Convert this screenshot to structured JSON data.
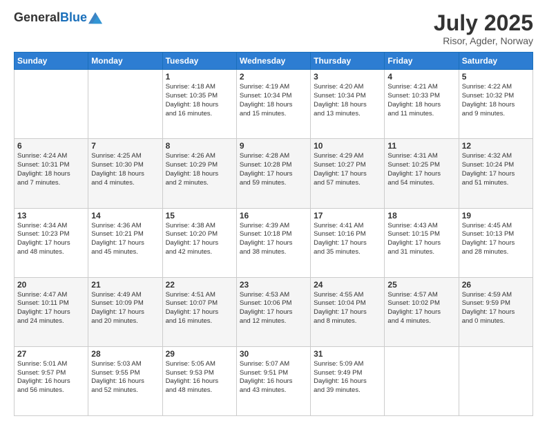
{
  "logo": {
    "text_general": "General",
    "text_blue": "Blue"
  },
  "header": {
    "title": "July 2025",
    "subtitle": "Risor, Agder, Norway"
  },
  "days_of_week": [
    "Sunday",
    "Monday",
    "Tuesday",
    "Wednesday",
    "Thursday",
    "Friday",
    "Saturday"
  ],
  "weeks": [
    [
      {
        "day": "",
        "detail": ""
      },
      {
        "day": "",
        "detail": ""
      },
      {
        "day": "1",
        "detail": "Sunrise: 4:18 AM\nSunset: 10:35 PM\nDaylight: 18 hours\nand 16 minutes."
      },
      {
        "day": "2",
        "detail": "Sunrise: 4:19 AM\nSunset: 10:34 PM\nDaylight: 18 hours\nand 15 minutes."
      },
      {
        "day": "3",
        "detail": "Sunrise: 4:20 AM\nSunset: 10:34 PM\nDaylight: 18 hours\nand 13 minutes."
      },
      {
        "day": "4",
        "detail": "Sunrise: 4:21 AM\nSunset: 10:33 PM\nDaylight: 18 hours\nand 11 minutes."
      },
      {
        "day": "5",
        "detail": "Sunrise: 4:22 AM\nSunset: 10:32 PM\nDaylight: 18 hours\nand 9 minutes."
      }
    ],
    [
      {
        "day": "6",
        "detail": "Sunrise: 4:24 AM\nSunset: 10:31 PM\nDaylight: 18 hours\nand 7 minutes."
      },
      {
        "day": "7",
        "detail": "Sunrise: 4:25 AM\nSunset: 10:30 PM\nDaylight: 18 hours\nand 4 minutes."
      },
      {
        "day": "8",
        "detail": "Sunrise: 4:26 AM\nSunset: 10:29 PM\nDaylight: 18 hours\nand 2 minutes."
      },
      {
        "day": "9",
        "detail": "Sunrise: 4:28 AM\nSunset: 10:28 PM\nDaylight: 17 hours\nand 59 minutes."
      },
      {
        "day": "10",
        "detail": "Sunrise: 4:29 AM\nSunset: 10:27 PM\nDaylight: 17 hours\nand 57 minutes."
      },
      {
        "day": "11",
        "detail": "Sunrise: 4:31 AM\nSunset: 10:25 PM\nDaylight: 17 hours\nand 54 minutes."
      },
      {
        "day": "12",
        "detail": "Sunrise: 4:32 AM\nSunset: 10:24 PM\nDaylight: 17 hours\nand 51 minutes."
      }
    ],
    [
      {
        "day": "13",
        "detail": "Sunrise: 4:34 AM\nSunset: 10:23 PM\nDaylight: 17 hours\nand 48 minutes."
      },
      {
        "day": "14",
        "detail": "Sunrise: 4:36 AM\nSunset: 10:21 PM\nDaylight: 17 hours\nand 45 minutes."
      },
      {
        "day": "15",
        "detail": "Sunrise: 4:38 AM\nSunset: 10:20 PM\nDaylight: 17 hours\nand 42 minutes."
      },
      {
        "day": "16",
        "detail": "Sunrise: 4:39 AM\nSunset: 10:18 PM\nDaylight: 17 hours\nand 38 minutes."
      },
      {
        "day": "17",
        "detail": "Sunrise: 4:41 AM\nSunset: 10:16 PM\nDaylight: 17 hours\nand 35 minutes."
      },
      {
        "day": "18",
        "detail": "Sunrise: 4:43 AM\nSunset: 10:15 PM\nDaylight: 17 hours\nand 31 minutes."
      },
      {
        "day": "19",
        "detail": "Sunrise: 4:45 AM\nSunset: 10:13 PM\nDaylight: 17 hours\nand 28 minutes."
      }
    ],
    [
      {
        "day": "20",
        "detail": "Sunrise: 4:47 AM\nSunset: 10:11 PM\nDaylight: 17 hours\nand 24 minutes."
      },
      {
        "day": "21",
        "detail": "Sunrise: 4:49 AM\nSunset: 10:09 PM\nDaylight: 17 hours\nand 20 minutes."
      },
      {
        "day": "22",
        "detail": "Sunrise: 4:51 AM\nSunset: 10:07 PM\nDaylight: 17 hours\nand 16 minutes."
      },
      {
        "day": "23",
        "detail": "Sunrise: 4:53 AM\nSunset: 10:06 PM\nDaylight: 17 hours\nand 12 minutes."
      },
      {
        "day": "24",
        "detail": "Sunrise: 4:55 AM\nSunset: 10:04 PM\nDaylight: 17 hours\nand 8 minutes."
      },
      {
        "day": "25",
        "detail": "Sunrise: 4:57 AM\nSunset: 10:02 PM\nDaylight: 17 hours\nand 4 minutes."
      },
      {
        "day": "26",
        "detail": "Sunrise: 4:59 AM\nSunset: 9:59 PM\nDaylight: 17 hours\nand 0 minutes."
      }
    ],
    [
      {
        "day": "27",
        "detail": "Sunrise: 5:01 AM\nSunset: 9:57 PM\nDaylight: 16 hours\nand 56 minutes."
      },
      {
        "day": "28",
        "detail": "Sunrise: 5:03 AM\nSunset: 9:55 PM\nDaylight: 16 hours\nand 52 minutes."
      },
      {
        "day": "29",
        "detail": "Sunrise: 5:05 AM\nSunset: 9:53 PM\nDaylight: 16 hours\nand 48 minutes."
      },
      {
        "day": "30",
        "detail": "Sunrise: 5:07 AM\nSunset: 9:51 PM\nDaylight: 16 hours\nand 43 minutes."
      },
      {
        "day": "31",
        "detail": "Sunrise: 5:09 AM\nSunset: 9:49 PM\nDaylight: 16 hours\nand 39 minutes."
      },
      {
        "day": "",
        "detail": ""
      },
      {
        "day": "",
        "detail": ""
      }
    ]
  ]
}
